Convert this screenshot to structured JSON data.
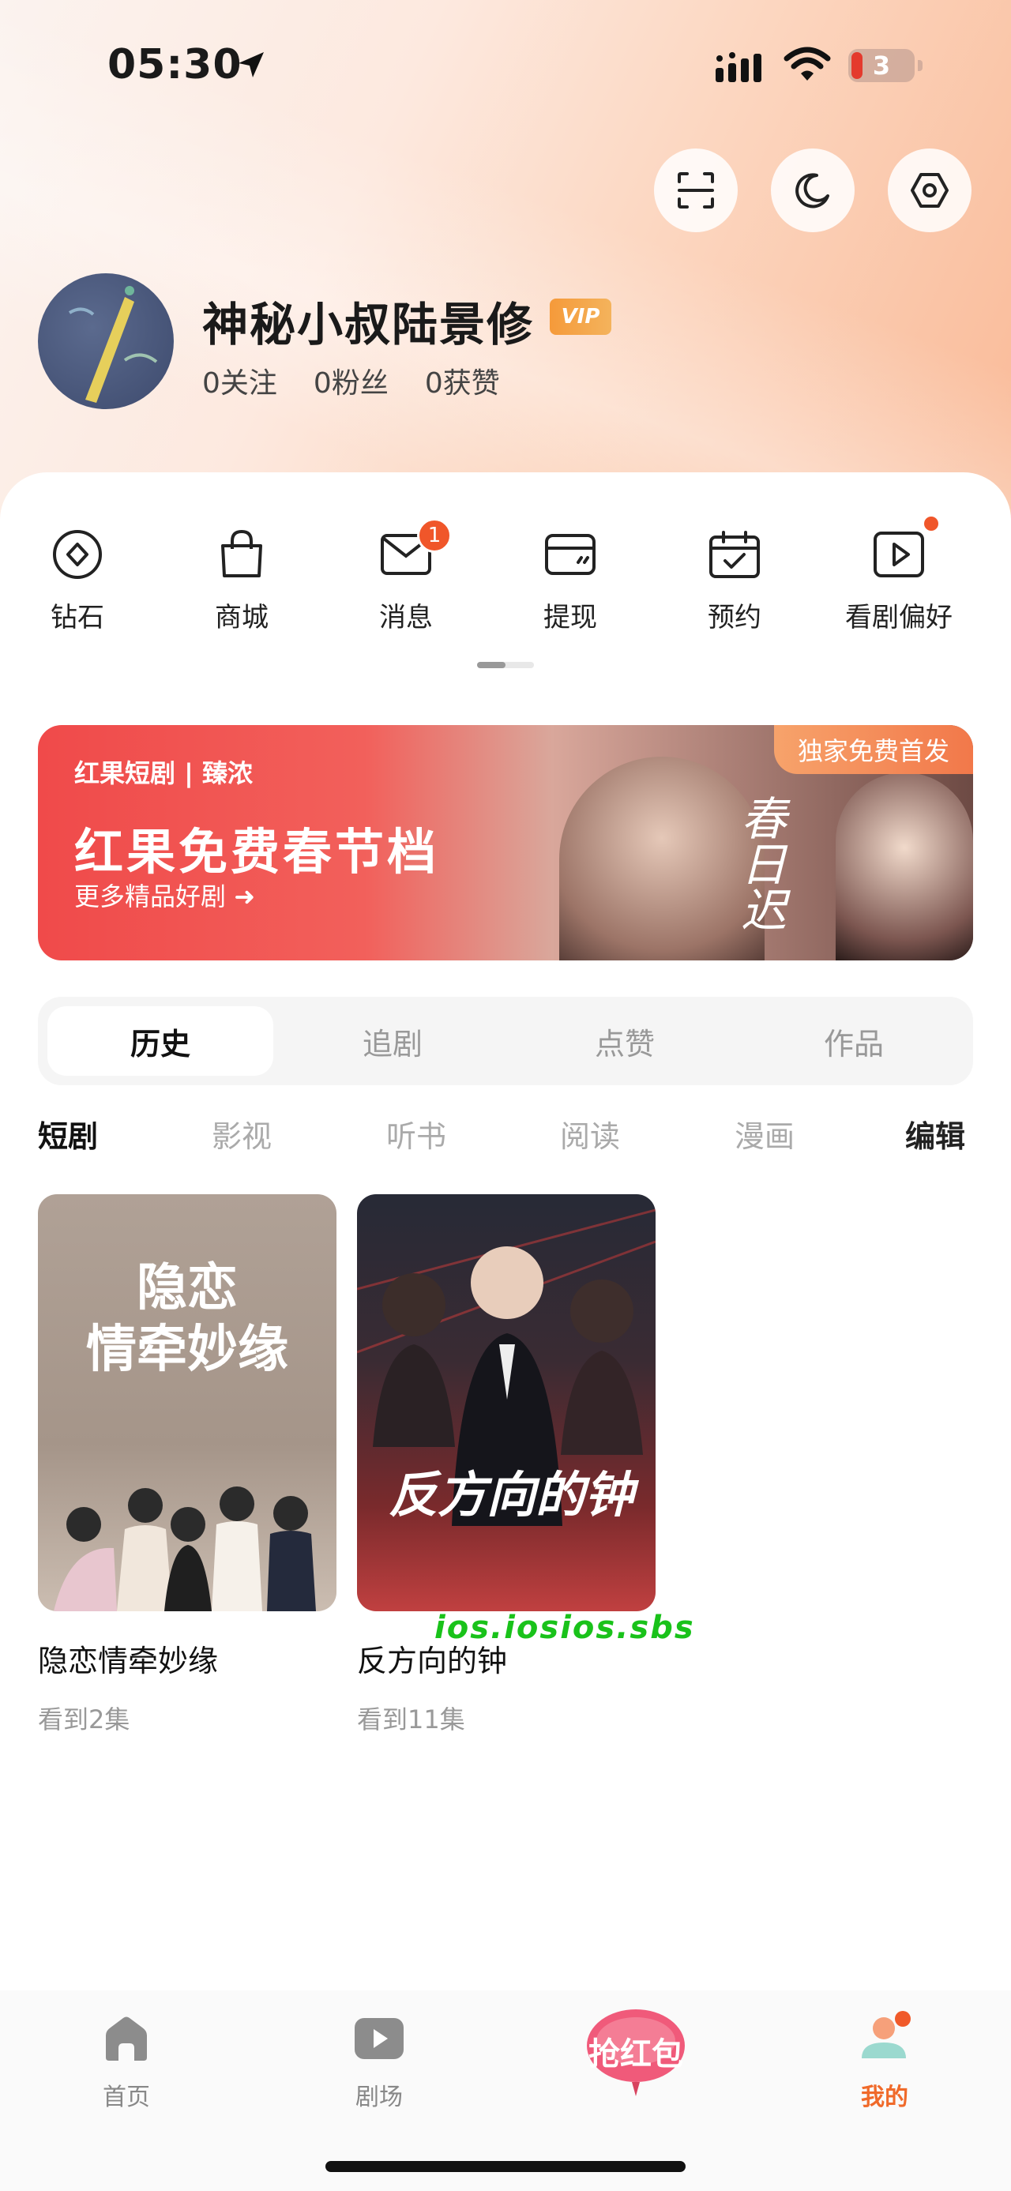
{
  "status_bar": {
    "time": "05:30",
    "battery": "3"
  },
  "profile": {
    "username": "神秘小叔陆景修",
    "vip_badge": "VIP",
    "following": "0",
    "following_label": "关注",
    "followers": "0",
    "followers_label": "粉丝",
    "likes": "0",
    "likes_label": "获赞"
  },
  "quick_actions": [
    {
      "label": "钻石",
      "icon": "diamond-icon"
    },
    {
      "label": "商城",
      "icon": "shopping-bag-icon"
    },
    {
      "label": "消息",
      "icon": "mail-icon",
      "badge": "1"
    },
    {
      "label": "提现",
      "icon": "wallet-icon"
    },
    {
      "label": "预约",
      "icon": "calendar-check-icon"
    },
    {
      "label": "看剧偏好",
      "icon": "play-square-icon"
    }
  ],
  "banner": {
    "brand": "红果短剧 | 臻浓",
    "title": "红果免费春节档",
    "subtitle": "更多精品好剧",
    "tag": "独家免费首发",
    "calligraphy": "春日迟"
  },
  "segments": [
    "历史",
    "追剧",
    "点赞",
    "作品"
  ],
  "active_segment": "历史",
  "sub_tabs": [
    "短剧",
    "影视",
    "听书",
    "阅读",
    "漫画"
  ],
  "edit_label": "编辑",
  "history": [
    {
      "title": "隐恋情牵妙缘",
      "poster_title": "隐恋\n情牵妙缘",
      "progress": "看到2集"
    },
    {
      "title": "反方向的钟",
      "poster_title": "反方向的钟",
      "progress": "看到11集"
    }
  ],
  "watermark": "ios.iosios.sbs",
  "bottom_nav": [
    {
      "label": "首页",
      "icon": "home-icon"
    },
    {
      "label": "剧场",
      "icon": "play-icon"
    },
    {
      "label": "抢红包",
      "icon": "red-packet-icon"
    },
    {
      "label": "我的",
      "icon": "profile-icon"
    }
  ],
  "accent_color": "#f06a2a"
}
